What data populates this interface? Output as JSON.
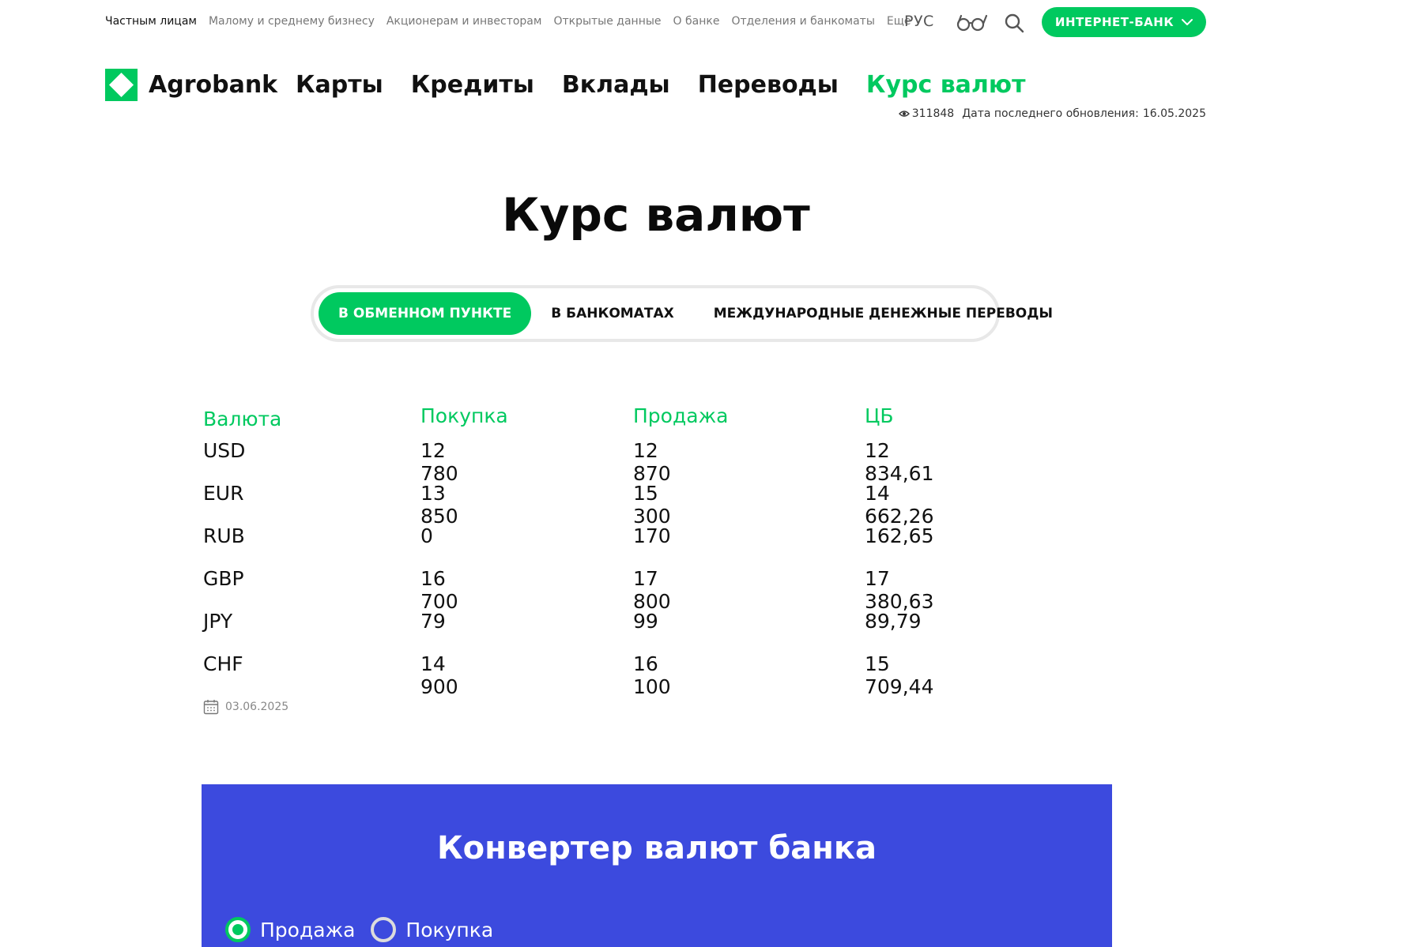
{
  "topnav": {
    "items": [
      {
        "label": "Частным лицам",
        "active": true
      },
      {
        "label": "Малому и среднему бизнесу"
      },
      {
        "label": "Акционерам и инвесторам"
      },
      {
        "label": "Открытые данные"
      },
      {
        "label": "О банке"
      },
      {
        "label": "Отделения и банкоматы"
      },
      {
        "label": "Еще"
      }
    ],
    "language": "РУС",
    "internet_bank_label": "ИНТЕРНЕТ-БАНК"
  },
  "brand": {
    "name": "Agrobank",
    "accent": "#00c95f"
  },
  "mainnav": {
    "items": [
      {
        "label": "Карты"
      },
      {
        "label": "Кредиты"
      },
      {
        "label": "Вклады"
      },
      {
        "label": "Переводы"
      },
      {
        "label": "Курс валют",
        "active": true
      }
    ]
  },
  "meta": {
    "views": "311848",
    "updated_label": "Дата последнего обновления:",
    "updated_date": "16.05.2025"
  },
  "page": {
    "title": "Курс валют"
  },
  "tabs": [
    {
      "label": "В ОБМЕННОМ ПУНКТЕ",
      "active": true
    },
    {
      "label": "В БАНКОМАТАХ"
    },
    {
      "label": "МЕЖДУНАРОДНЫЕ ДЕНЕЖНЫЕ ПЕРЕВОДЫ"
    }
  ],
  "rates": {
    "headers": [
      "Валюта",
      "Покупка",
      "Продажа",
      "ЦБ"
    ],
    "rows": [
      [
        "USD",
        "12 780",
        "12 870",
        "12 834,61"
      ],
      [
        "EUR",
        "13 850",
        "15 300",
        "14 662,26"
      ],
      [
        "RUB",
        "0",
        "170",
        "162,65"
      ],
      [
        "GBP",
        "16 700",
        "17 800",
        "17 380,63"
      ],
      [
        "JPY",
        "79",
        "99",
        "89,79"
      ],
      [
        "CHF",
        "14 900",
        "16 100",
        "15 709,44"
      ]
    ],
    "date": "03.06.2025"
  },
  "converter": {
    "title": "Конвертер валют банка",
    "background": "#3c4ade",
    "options": [
      {
        "label": "Продажа",
        "selected": true
      },
      {
        "label": "Покупка"
      }
    ]
  }
}
